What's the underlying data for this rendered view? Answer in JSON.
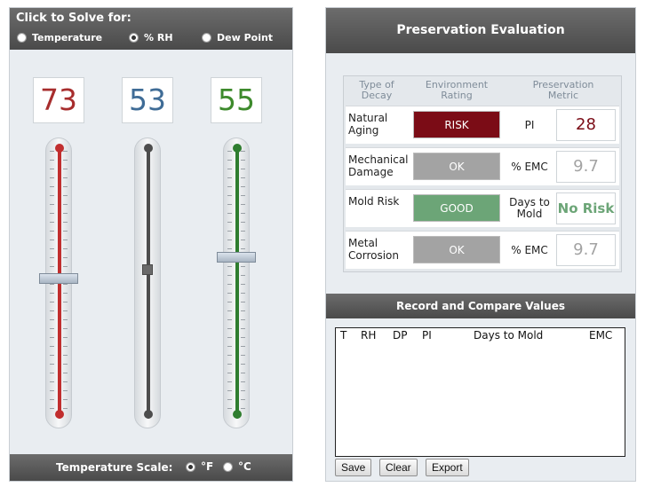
{
  "solver": {
    "title": "Click to Solve for:",
    "options": [
      {
        "label": "Temperature",
        "selected": false
      },
      {
        "label": "% RH",
        "selected": true
      },
      {
        "label": "Dew Point",
        "selected": false
      }
    ]
  },
  "gauges": {
    "temperature": {
      "value": "73",
      "color": "#a72d2d"
    },
    "rh": {
      "value": "53",
      "color": "#3f6c96"
    },
    "dew_point": {
      "value": "55",
      "color": "#3d8a2c"
    }
  },
  "scale": {
    "label": "Temperature Scale:",
    "options": [
      {
        "label": "°F",
        "selected": true
      },
      {
        "label": "°C",
        "selected": false
      }
    ]
  },
  "evaluation": {
    "title": "Preservation Evaluation",
    "headers": {
      "type": "Type of Decay",
      "rating": "Environment Rating",
      "metric": "Preservation Metric"
    },
    "rows": [
      {
        "name": "Natural Aging",
        "rating": "RISK",
        "rating_color": "#7b0c16",
        "metric_label": "PI",
        "metric_value": "28",
        "value_color": "#7b0c16"
      },
      {
        "name": "Mechanical Damage",
        "rating": "OK",
        "rating_color": "#a3a3a3",
        "metric_label": "% EMC",
        "metric_value": "9.7",
        "value_color": "#a3a3a3"
      },
      {
        "name": "Mold Risk",
        "rating": "GOOD",
        "rating_color": "#6ca577",
        "metric_label": "Days to Mold",
        "metric_value": "No Risk",
        "value_color": "#6ca577"
      },
      {
        "name": "Metal Corrosion",
        "rating": "OK",
        "rating_color": "#a3a3a3",
        "metric_label": "% EMC",
        "metric_value": "9.7",
        "value_color": "#a3a3a3"
      }
    ]
  },
  "record": {
    "title": "Record and Compare Values",
    "columns": [
      "T",
      "RH",
      "DP",
      "PI",
      "Days to Mold",
      "EMC"
    ],
    "buttons": {
      "save": "Save",
      "clear": "Clear",
      "export": "Export"
    }
  }
}
